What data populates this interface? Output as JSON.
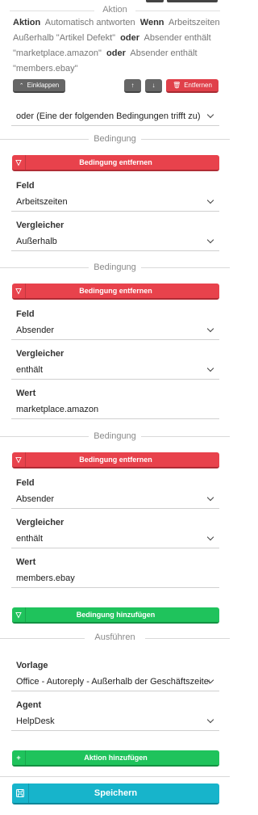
{
  "action_section": {
    "title": "Aktion",
    "summary": {
      "aktion_kw": "Aktion",
      "aktion_val": "Automatisch antworten",
      "wenn_kw": "Wenn",
      "cond1_text": "Arbeitszeiten Außerhalb \"Artikel Defekt\"",
      "oder1_kw": "oder",
      "cond2_text": "Absender enthält \"marketplace.amazon\"",
      "oder2_kw": "oder",
      "cond3_text": "Absender enthält \"members.ebay\""
    },
    "collapse_label": "Einklappen",
    "up_label": "↑",
    "down_label": "↓",
    "remove_label": "Entfernen",
    "logic_select": "oder (Eine der folgenden Bedingungen trifft zu)"
  },
  "conditions": [
    {
      "title": "Bedingung",
      "remove_label": "Bedingung entfernen",
      "field_label": "Feld",
      "field_value": "Arbeitszeiten",
      "comparator_label": "Vergleicher",
      "comparator_value": "Außerhalb"
    },
    {
      "title": "Bedingung",
      "remove_label": "Bedingung entfernen",
      "field_label": "Feld",
      "field_value": "Absender",
      "comparator_label": "Vergleicher",
      "comparator_value": "enthält",
      "value_label": "Wert",
      "value_value": "marketplace.amazon"
    },
    {
      "title": "Bedingung",
      "remove_label": "Bedingung entfernen",
      "field_label": "Feld",
      "field_value": "Absender",
      "comparator_label": "Vergleicher",
      "comparator_value": "enthält",
      "value_label": "Wert",
      "value_value": "members.ebay"
    }
  ],
  "add_condition_label": "Bedingung hinzufügen",
  "execute_section": {
    "title": "Ausführen",
    "template_label": "Vorlage",
    "template_value": "Office - Autoreply - Außerhalb der Geschäftszeiten",
    "agent_label": "Agent",
    "agent_value": "HelpDesk",
    "add_action_label": "Aktion hinzufügen"
  },
  "save_label": "Speichern",
  "icons": {
    "filter": "filter-icon",
    "trash": "trash-icon",
    "plus": "plus-icon",
    "save": "floppy-disk-icon",
    "chevron": "chevron-down-icon"
  },
  "colors": {
    "danger": "#e8424c",
    "success": "#1fc35c",
    "primary": "#17b4cb",
    "dark": "#666666"
  }
}
